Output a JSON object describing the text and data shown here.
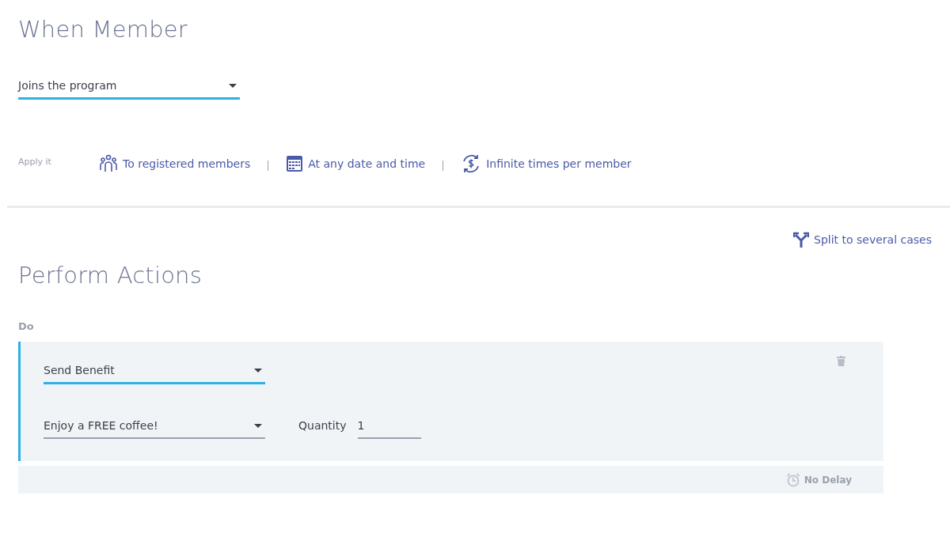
{
  "trigger": {
    "title": "When Member",
    "event": {
      "value": "Joins the program",
      "active": true
    }
  },
  "apply": {
    "label": "Apply it",
    "options": [
      {
        "kind": "members",
        "text": "To registered members"
      },
      {
        "kind": "calendar",
        "text": "At any date and time"
      },
      {
        "kind": "repeat",
        "text": "Infinite times per member"
      }
    ]
  },
  "split_link": "Split to several cases",
  "actions": {
    "title": "Perform Actions",
    "do_label": "Do",
    "items": [
      {
        "action": {
          "value": "Send Benefit",
          "active": true
        },
        "benefit": {
          "value": "Enjoy a FREE coffee!",
          "active": false
        },
        "quantity_label": "Quantity",
        "quantity": "1",
        "delay": "No Delay"
      }
    ]
  }
}
